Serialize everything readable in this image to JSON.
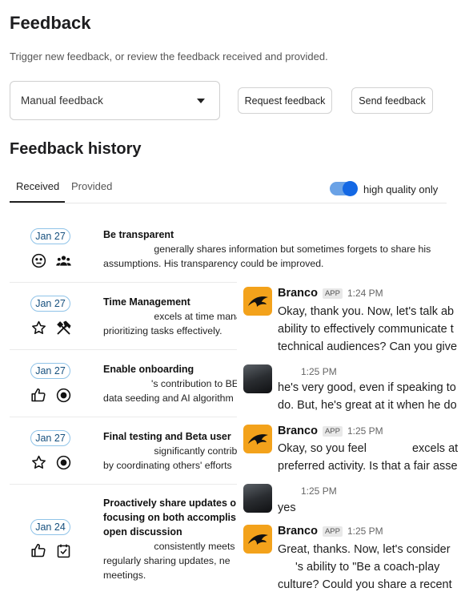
{
  "page": {
    "title": "Feedback",
    "subtitle": "Trigger new feedback, or review the feedback received and provided."
  },
  "controls": {
    "select_value": "Manual feedback",
    "request_label": "Request feedback",
    "send_label": "Send feedback"
  },
  "history": {
    "title": "Feedback history",
    "tabs": [
      {
        "label": "Received",
        "active": true
      },
      {
        "label": "Provided",
        "active": false
      }
    ],
    "toggle_label": "high quality only",
    "toggle_on": true,
    "items": [
      {
        "date": "Jan 27",
        "title": "Be transparent",
        "text1": " generally shares information but sometimes forgets to share his",
        "text2": "assumptions. His transparency could be improved.",
        "icons": [
          "neutral-face-icon",
          "group-icon"
        ]
      },
      {
        "date": "Jan 27",
        "title": "Time Management",
        "text1": " excels at time manag",
        "text2": "prioritizing tasks effectively.",
        "icons": [
          "star-icon",
          "tools-icon"
        ]
      },
      {
        "date": "Jan 27",
        "title": "Enable onboarding",
        "text1": "'s contribution to BETA",
        "text2": "data seeding and AI algorithm",
        "icons": [
          "thumbs-up-icon",
          "target-icon"
        ]
      },
      {
        "date": "Jan 27",
        "title": "Final testing and Beta user",
        "text1": " significantly contribut",
        "text2": "by coordinating others' efforts",
        "icons": [
          "star-icon",
          "target-icon"
        ]
      },
      {
        "date": "Jan 24",
        "title1": "Proactively share updates o",
        "title2": "focusing on both accomplis",
        "title3": "open discussion",
        "text1": " consistently meets ex",
        "text2": "regularly sharing updates, ne",
        "text3": "meetings.",
        "icons": [
          "thumbs-up-icon",
          "checkbox-icon"
        ]
      }
    ]
  },
  "chat": {
    "messages": [
      {
        "sender": "Branco",
        "badge": "APP",
        "time": "1:24 PM",
        "lines": [
          "Okay, thank you. Now, let's talk ab",
          "ability to effectively communicate t",
          "technical audiences? Can you give"
        ]
      },
      {
        "sender": "",
        "time": "1:25 PM",
        "lines": [
          "he's very good, even if speaking to",
          "do. But, he's great at it when he do"
        ]
      },
      {
        "sender": "Branco",
        "badge": "APP",
        "time": "1:25 PM",
        "lines": [
          "Okay, so you feel",
          "excels at t",
          "preferred activity. Is that a fair asse"
        ]
      },
      {
        "sender": "",
        "time": "1:25 PM",
        "lines": [
          "yes"
        ]
      },
      {
        "sender": "Branco",
        "badge": "APP",
        "time": "1:25 PM",
        "lines": [
          "Great, thanks.  Now, let's consider",
          "'s ability to \"Be a coach-play",
          "culture?  Could you share a recent"
        ]
      }
    ]
  }
}
